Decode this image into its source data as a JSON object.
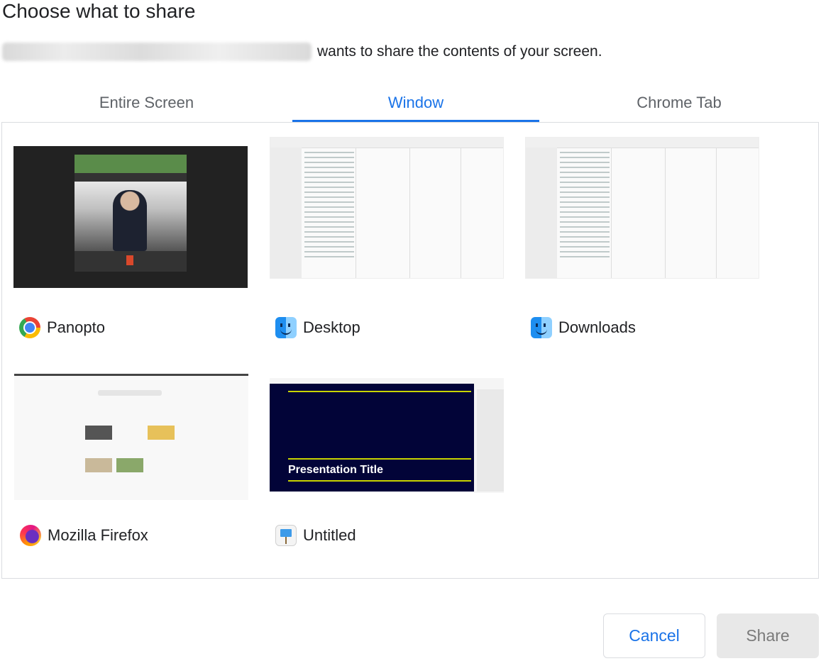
{
  "dialog": {
    "title": "Choose what to share",
    "subtitle_text": "wants to share the contents of your screen."
  },
  "tabs": [
    {
      "label": "Entire Screen",
      "selected": false
    },
    {
      "label": "Window",
      "selected": true
    },
    {
      "label": "Chrome Tab",
      "selected": false
    }
  ],
  "sources": [
    {
      "label": "Panopto",
      "icon": "chrome-icon"
    },
    {
      "label": "Desktop",
      "icon": "finder-icon"
    },
    {
      "label": "Downloads",
      "icon": "finder-icon"
    },
    {
      "label": "Mozilla Firefox",
      "icon": "firefox-icon"
    },
    {
      "label": "Untitled",
      "icon": "keynote-icon",
      "thumbnail_text": "Presentation Title"
    }
  ],
  "buttons": {
    "cancel": "Cancel",
    "share": "Share"
  },
  "colors": {
    "accent": "#1a73e8",
    "disabled_bg": "#e8e8e8",
    "disabled_text": "#7a7a7a"
  }
}
